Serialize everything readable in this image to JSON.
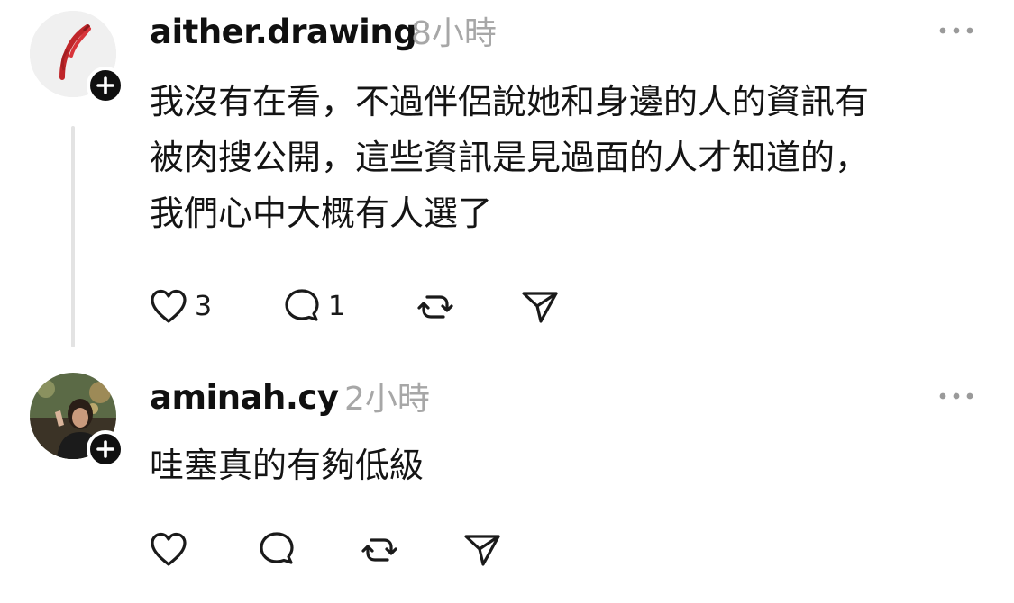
{
  "posts": [
    {
      "username": "aither.drawing",
      "time": "8小時",
      "text_lines": [
        "我沒有在看，不過伴侶說她和身邊的人的資訊有",
        "被肉搜公開，這些資訊是見過面的人才知道的，",
        "我們心中大概有人選了"
      ],
      "likes": "3",
      "replies": "1"
    },
    {
      "username": "aminah.cy",
      "time": "2小時",
      "text_lines": [
        "哇塞真的有夠低級"
      ],
      "likes": "",
      "replies": ""
    }
  ],
  "icons": {
    "like": "heart-icon",
    "reply": "comment-bubble-icon",
    "repost": "repost-icon",
    "share": "send-icon",
    "more": "more-horizontal-icon",
    "follow": "plus-icon"
  },
  "colors": {
    "text": "#101010",
    "muted": "#a7a7a7",
    "divider": "#e3e3e3",
    "badge": "#0f0f0f"
  }
}
